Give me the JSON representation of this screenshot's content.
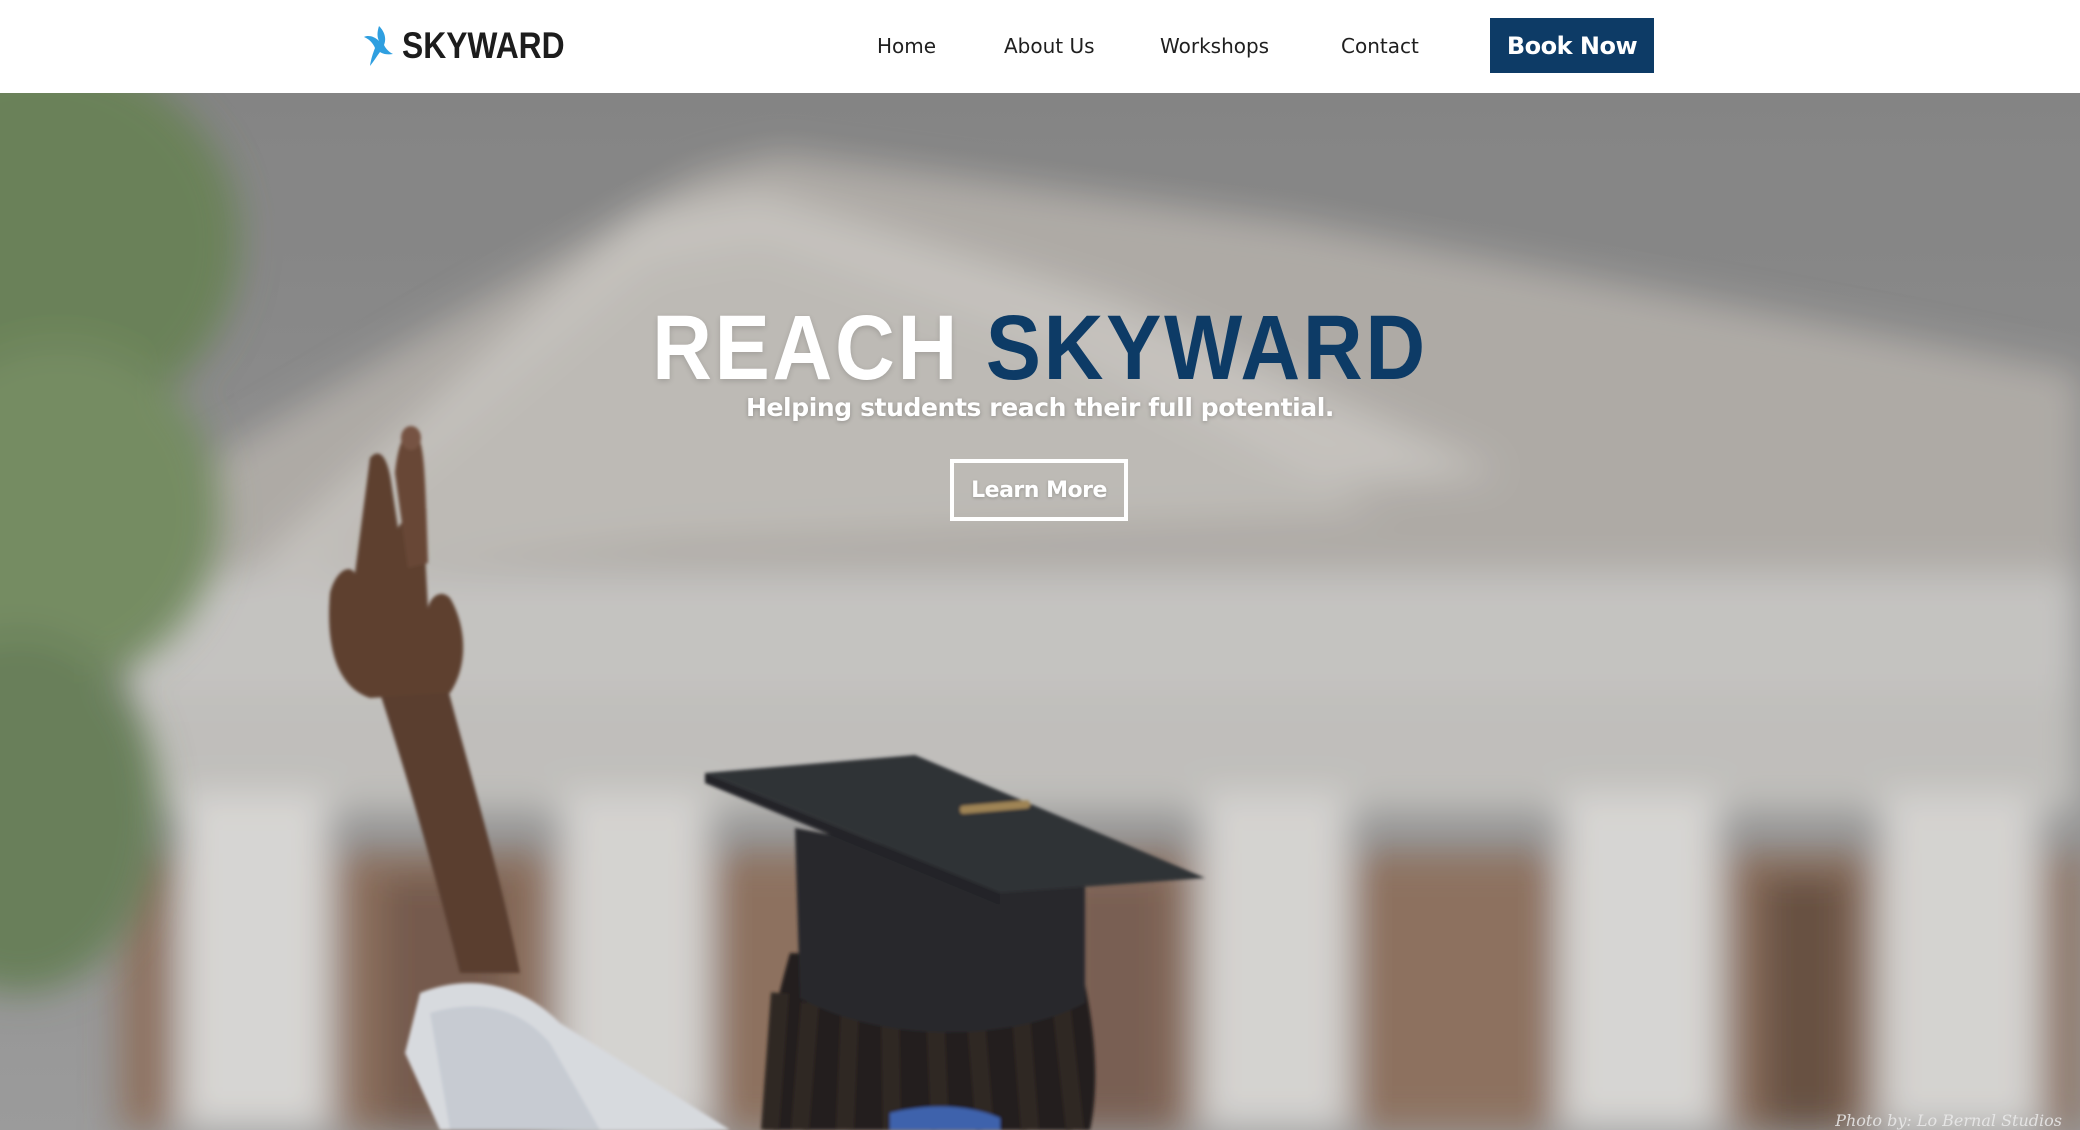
{
  "header": {
    "brand": "SKYWARD",
    "logo_icon": "bird-icon",
    "nav": {
      "home": "Home",
      "about": "About Us",
      "workshops": "Workshops",
      "contact": "Contact"
    },
    "book_label": "Book Now"
  },
  "hero": {
    "title_part1": "REACH",
    "title_part2": "SKYWARD",
    "subtitle": "Helping students reach their full potential.",
    "cta_label": "Learn More",
    "photo_credit": "Photo by: Lo Bernal Studios",
    "background_image": "graduate-pointing-up-photo"
  },
  "colors": {
    "brand_navy": "#0d3b66",
    "logo_blue": "#2f9fe0",
    "header_bg": "#ffffff",
    "nav_text": "#1f1f1f"
  }
}
